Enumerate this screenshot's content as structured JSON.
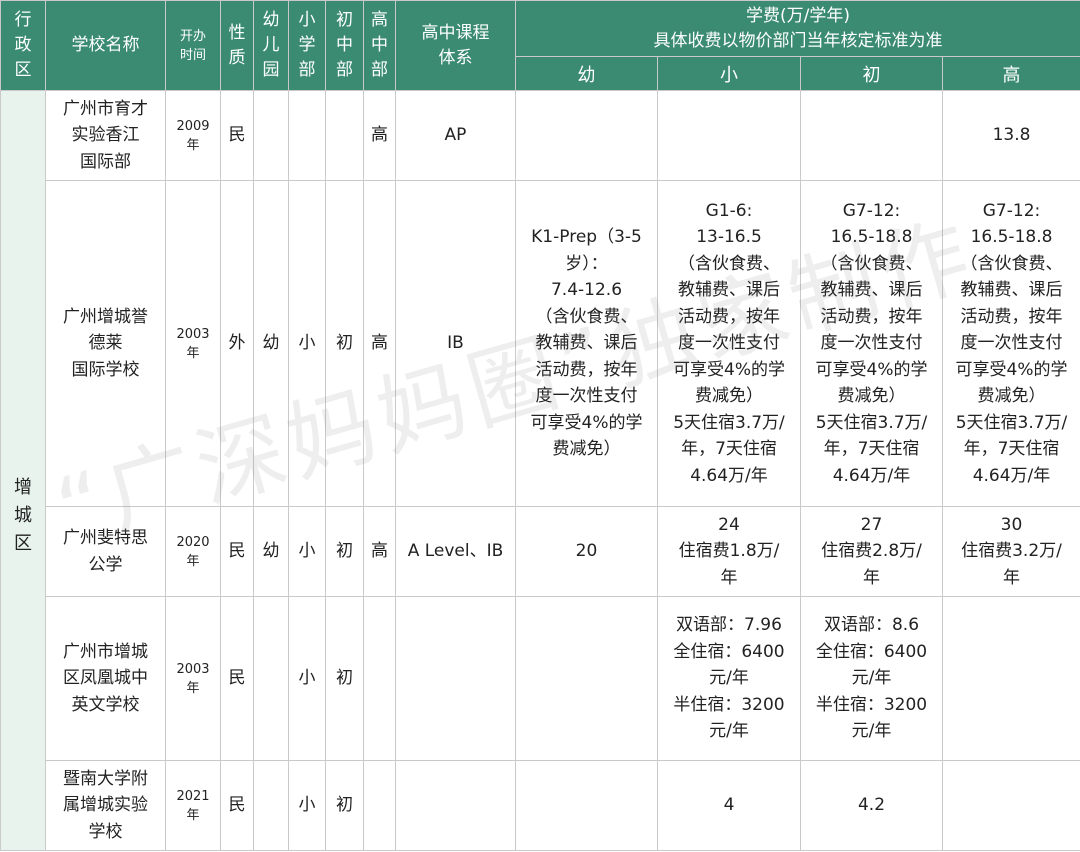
{
  "header": {
    "region": "行\n政\n区",
    "school_name": "学校名称",
    "founded": "开办\n时间",
    "nature": "性\n质",
    "kindergarten": "幼\n儿\n园",
    "primary": "小\n学\n部",
    "middle": "初\n中\n部",
    "high": "高\n中\n部",
    "curriculum": "高中课程\n体系",
    "fees_title": "学费(万/学年)\n具体收费以物价部门当年核定标准为准",
    "fee_cols": [
      "幼",
      "小",
      "初",
      "高"
    ]
  },
  "region": "增\n城\n区",
  "rows": [
    {
      "name": "广州市育才\n实验香江\n国际部",
      "founded": "2009\n年",
      "nature": "民",
      "kindergarten": "",
      "primary": "",
      "middle": "",
      "high": "高",
      "curriculum": "AP",
      "fee_k": "",
      "fee_p": "",
      "fee_m": "",
      "fee_h": "13.8"
    },
    {
      "name": "广州增城誉\n德莱\n国际学校",
      "founded": "2003\n年",
      "nature": "外",
      "kindergarten": "幼",
      "primary": "小",
      "middle": "初",
      "high": "高",
      "curriculum": "IB",
      "fee_k": "K1-Prep（3-5\n岁）：\n7.4-12.6\n（含伙食费、\n教辅费、课后\n活动费，按年\n度一次性支付\n可享受4%的学\n费减免）",
      "fee_p": "G1-6:\n13-16.5\n（含伙食费、\n教辅费、课后\n活动费，按年\n度一次性支付\n可享受4%的学\n费减免）\n5天住宿3.7万/\n年，7天住宿\n4.64万/年",
      "fee_m": "G7-12:\n16.5-18.8\n（含伙食费、\n教辅费、课后\n活动费，按年\n度一次性支付\n可享受4%的学\n费减免）\n5天住宿3.7万/\n年，7天住宿\n4.64万/年",
      "fee_h": "G7-12:\n16.5-18.8\n（含伙食费、\n教辅费、课后\n活动费，按年\n度一次性支付\n可享受4%的学\n费减免）\n5天住宿3.7万/\n年，7天住宿\n4.64万/年"
    },
    {
      "name": "广州斐特思\n公学",
      "founded": "2020\n年",
      "nature": "民",
      "kindergarten": "幼",
      "primary": "小",
      "middle": "初",
      "high": "高",
      "curriculum": "A Level、IB",
      "fee_k": "20",
      "fee_p": "24\n住宿费1.8万/\n年",
      "fee_m": "27\n住宿费2.8万/\n年",
      "fee_h": "30\n住宿费3.2万/\n年"
    },
    {
      "name": "广州市增城\n区凤凰城中\n英文学校",
      "founded": "2003\n年",
      "nature": "民",
      "kindergarten": "",
      "primary": "小",
      "middle": "初",
      "high": "",
      "curriculum": "",
      "fee_k": "",
      "fee_p": "双语部：7.96\n全住宿：6400\n元/年\n半住宿：3200\n元/年",
      "fee_m": "双语部：8.6\n全住宿：6400\n元/年\n半住宿：3200\n元/年",
      "fee_h": ""
    },
    {
      "name": "暨南大学附\n属增城实验\n学校",
      "founded": "2021\n年",
      "nature": "民",
      "kindergarten": "",
      "primary": "小",
      "middle": "初",
      "high": "",
      "curriculum": "",
      "fee_k": "",
      "fee_p": "4",
      "fee_m": "4.2",
      "fee_h": ""
    }
  ],
  "watermark": "“广深妈妈圈”独家制作",
  "colors": {
    "header_bg": "#3a8b71",
    "region_bg": "#e8f3ee",
    "grid": "#c9c9c9"
  }
}
